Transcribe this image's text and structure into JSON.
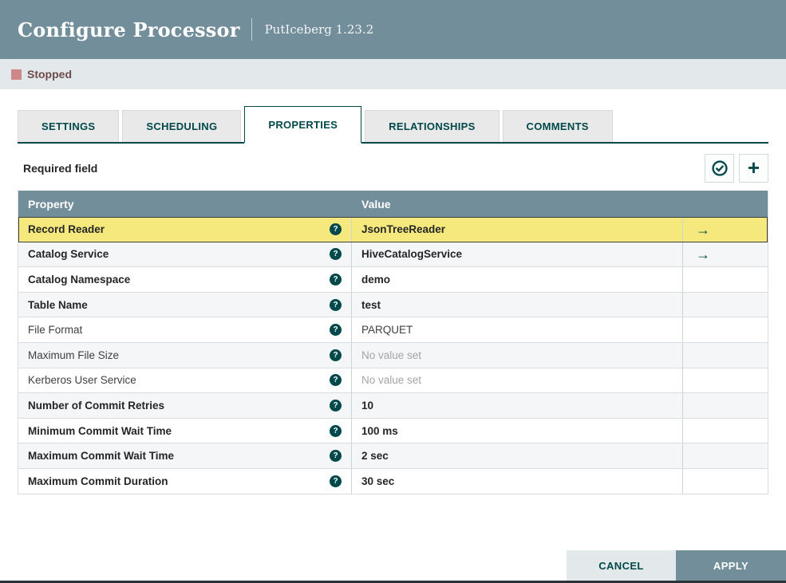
{
  "header": {
    "title": "Configure Processor",
    "subtitle": "PutIceberg 1.23.2"
  },
  "status": {
    "label": "Stopped",
    "state_color": "#cc8888"
  },
  "tabs": [
    {
      "label": "SETTINGS",
      "active": false
    },
    {
      "label": "SCHEDULING",
      "active": false
    },
    {
      "label": "PROPERTIES",
      "active": true
    },
    {
      "label": "RELATIONSHIPS",
      "active": false
    },
    {
      "label": "COMMENTS",
      "active": false
    }
  ],
  "toolbar": {
    "required_label": "Required field",
    "verify_icon": "check-circle",
    "add_icon": "plus"
  },
  "icon_glyphs": {
    "help": "?",
    "goto_arrow": "→",
    "plus": "+"
  },
  "table": {
    "columns": [
      "Property",
      "Value"
    ],
    "rows": [
      {
        "property": "Record Reader",
        "value": "JsonTreeReader",
        "required": true,
        "unset": false,
        "arrow": true,
        "selected": true
      },
      {
        "property": "Catalog Service",
        "value": "HiveCatalogService",
        "required": true,
        "unset": false,
        "arrow": true,
        "selected": false
      },
      {
        "property": "Catalog Namespace",
        "value": "demo",
        "required": true,
        "unset": false,
        "arrow": false,
        "selected": false
      },
      {
        "property": "Table Name",
        "value": "test",
        "required": true,
        "unset": false,
        "arrow": false,
        "selected": false
      },
      {
        "property": "File Format",
        "value": "PARQUET",
        "required": false,
        "unset": false,
        "arrow": false,
        "selected": false
      },
      {
        "property": "Maximum File Size",
        "value": "No value set",
        "required": false,
        "unset": true,
        "arrow": false,
        "selected": false
      },
      {
        "property": "Kerberos User Service",
        "value": "No value set",
        "required": false,
        "unset": true,
        "arrow": false,
        "selected": false
      },
      {
        "property": "Number of Commit Retries",
        "value": "10",
        "required": true,
        "unset": false,
        "arrow": false,
        "selected": false
      },
      {
        "property": "Minimum Commit Wait Time",
        "value": "100 ms",
        "required": true,
        "unset": false,
        "arrow": false,
        "selected": false
      },
      {
        "property": "Maximum Commit Wait Time",
        "value": "2 sec",
        "required": true,
        "unset": false,
        "arrow": false,
        "selected": false
      },
      {
        "property": "Maximum Commit Duration",
        "value": "30 sec",
        "required": true,
        "unset": false,
        "arrow": false,
        "selected": false
      }
    ]
  },
  "footer": {
    "cancel_label": "CANCEL",
    "apply_label": "APPLY"
  },
  "colors": {
    "header_bg": "#728e9b",
    "accent_teal": "#004849",
    "selected_row": "#f5e97e",
    "status_bar_bg": "#e3e8eb"
  }
}
